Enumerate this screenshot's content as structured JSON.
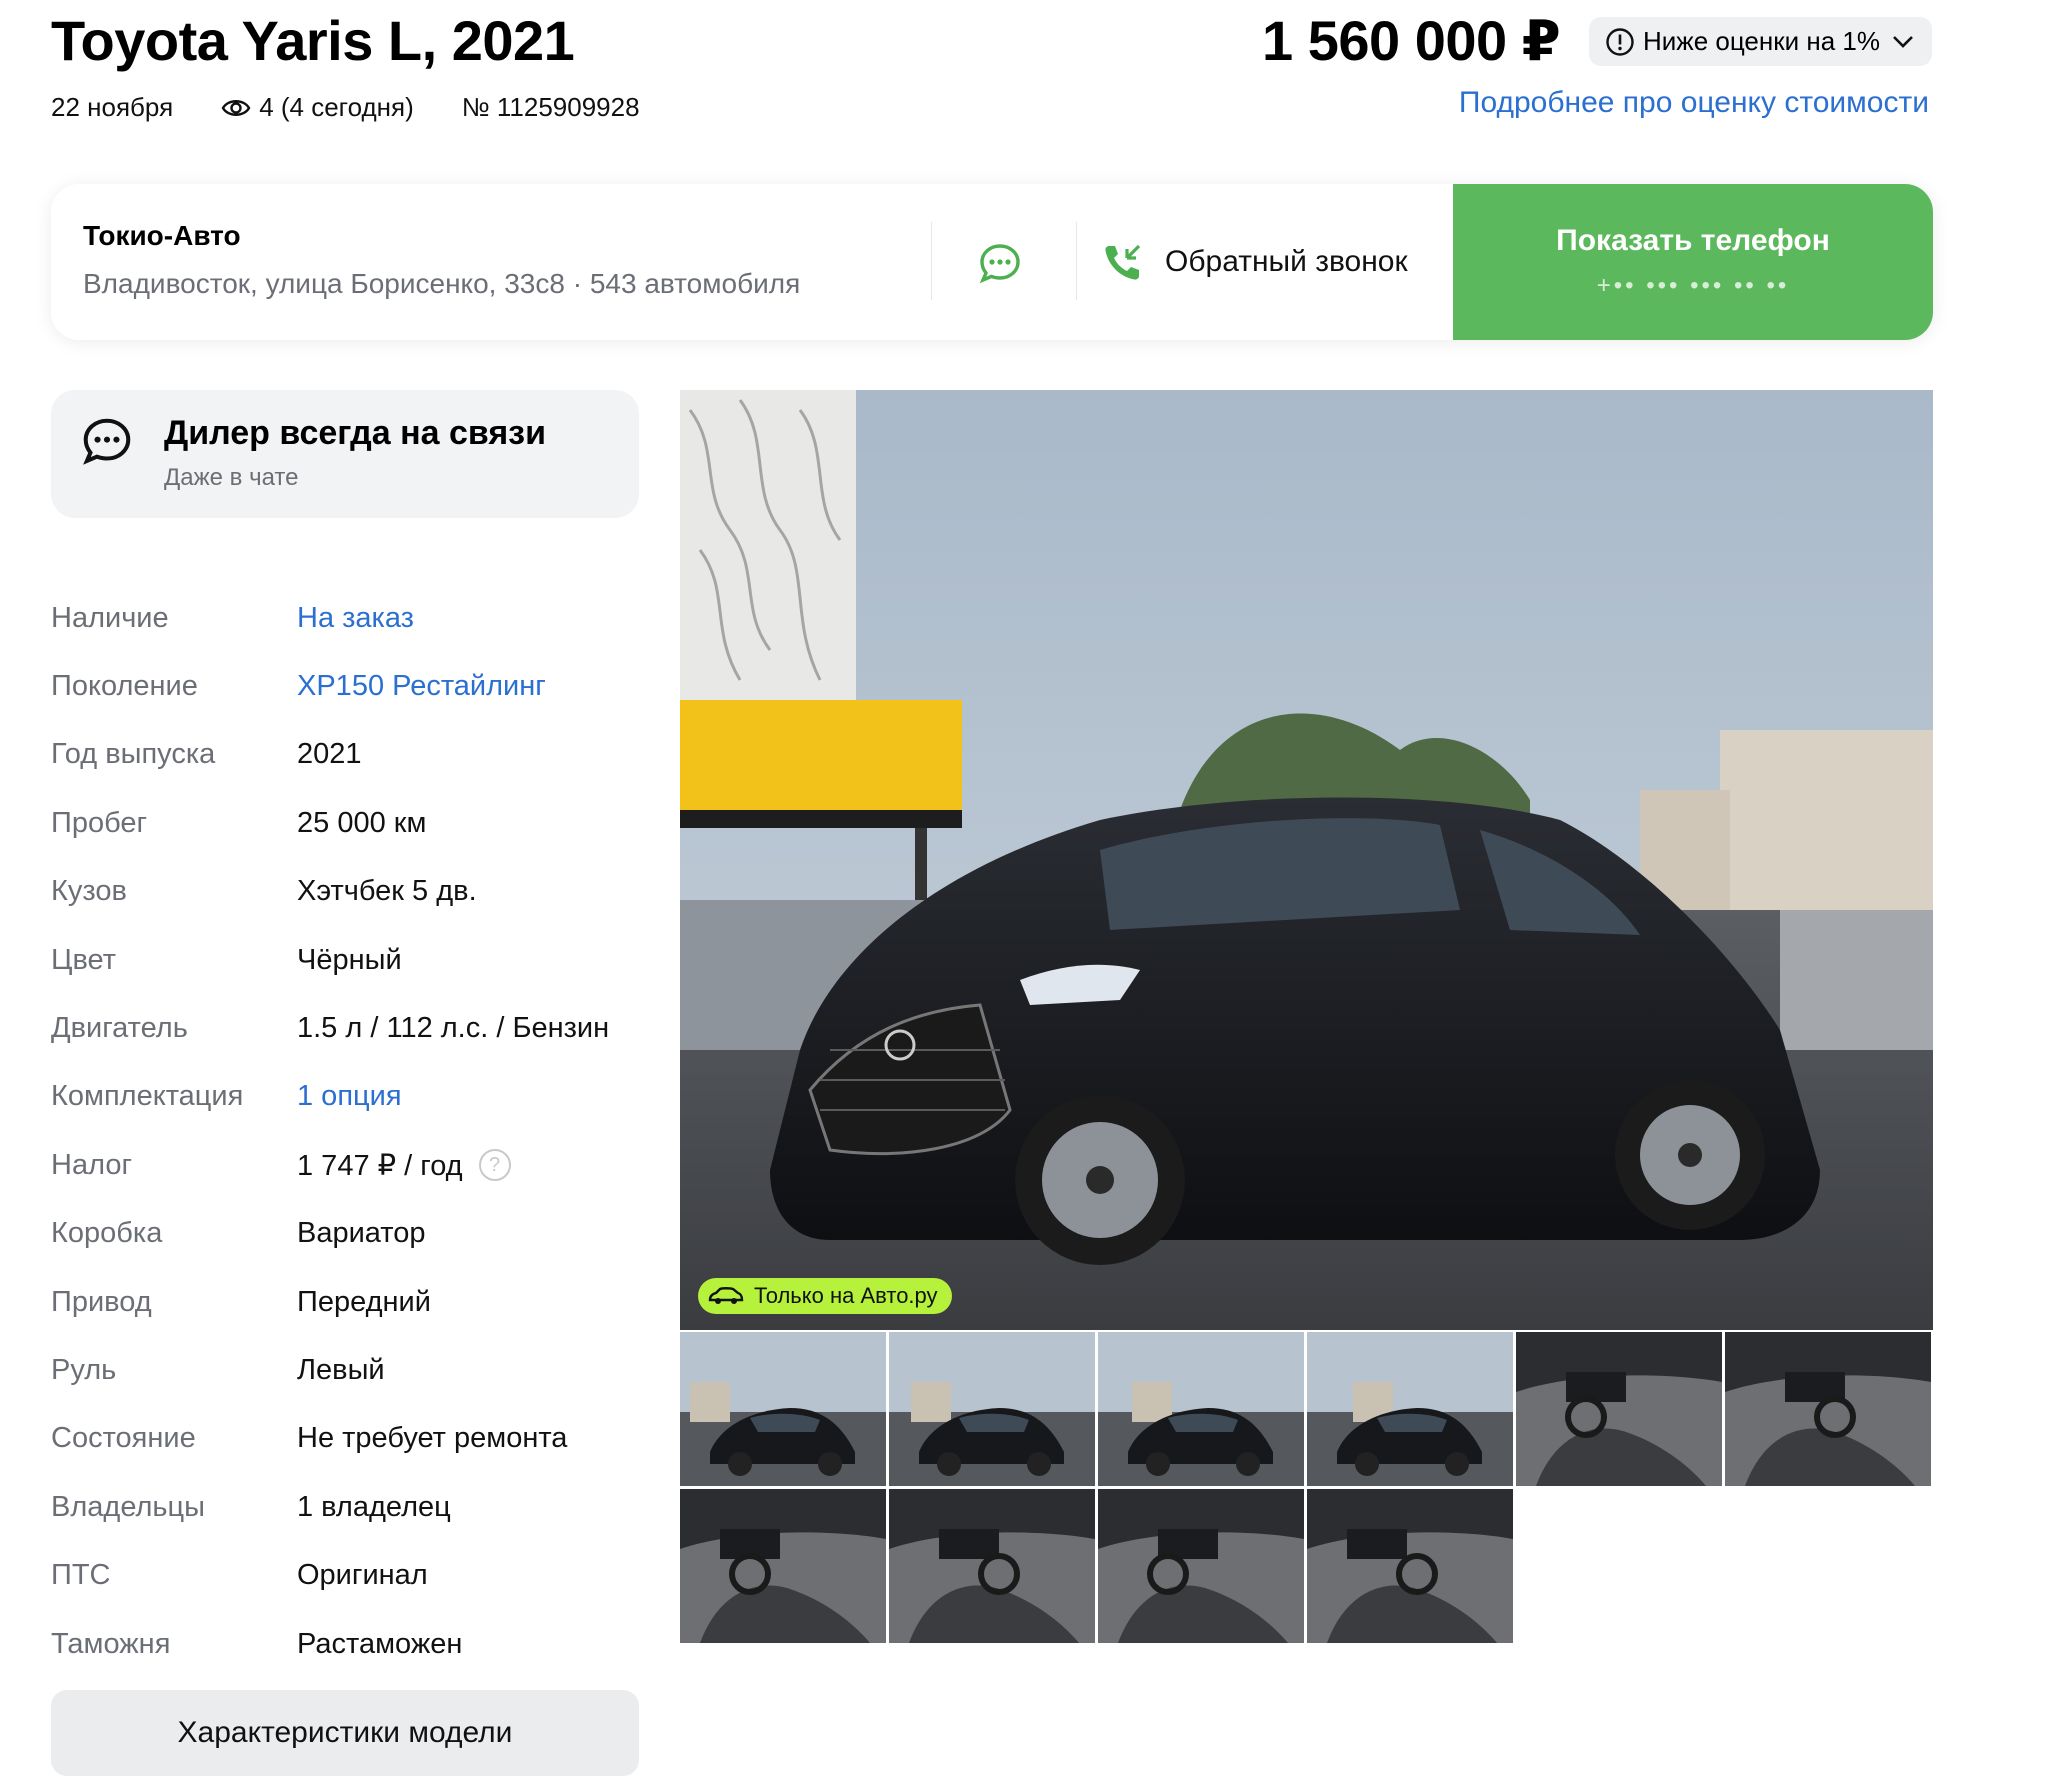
{
  "listing": {
    "title": "Toyota Yaris L, 2021",
    "date": "22 ноября",
    "views": "4 (4 сегодня)",
    "number": "№ 1125909928",
    "price": "1 560 000 ₽",
    "price_badge": "Ниже оценки на 1%",
    "eval_link": "Подробнее про оценку стоимости"
  },
  "dealer": {
    "name": "Токио-Авто",
    "address": "Владивосток, улица Борисенко, 33с8 · 543 автомобиля",
    "callback_label": "Обратный звонок",
    "phone_label": "Показать телефон",
    "phone_masked": "+•• ••• ••• •• ••"
  },
  "contact_box": {
    "title": "Дилер всегда на связи",
    "subtitle": "Даже в чате"
  },
  "specs": [
    {
      "label": "Наличие",
      "value": "На заказ",
      "link": true
    },
    {
      "label": "Поколение",
      "value": "XP150 Рестайлинг",
      "link": true
    },
    {
      "label": "Год выпуска",
      "value": "2021",
      "link": false
    },
    {
      "label": "Пробег",
      "value": "25 000 км",
      "link": false
    },
    {
      "label": "Кузов",
      "value": "Хэтчбек 5 дв.",
      "link": false
    },
    {
      "label": "Цвет",
      "value": "Чёрный",
      "link": false
    },
    {
      "label": "Двигатель",
      "value": "1.5 л / 112 л.с. / Бензин",
      "link": false
    },
    {
      "label": "Комплектация",
      "value": "1 опция",
      "link": true
    },
    {
      "label": "Налог",
      "value": "1 747 ₽ / год",
      "link": false,
      "help": true
    },
    {
      "label": "Коробка",
      "value": "Вариатор",
      "link": false
    },
    {
      "label": "Привод",
      "value": "Передний",
      "link": false
    },
    {
      "label": "Руль",
      "value": "Левый",
      "link": false
    },
    {
      "label": "Состояние",
      "value": "Не требует ремонта",
      "link": false
    },
    {
      "label": "Владельцы",
      "value": "1 владелец",
      "link": false
    },
    {
      "label": "ПТС",
      "value": "Оригинал",
      "link": false
    },
    {
      "label": "Таможня",
      "value": "Растаможен",
      "link": false
    }
  ],
  "model_button": "Характеристики модели",
  "gallery": {
    "only_badge": "Только на Авто.ру",
    "thumbnails": [
      "exterior",
      "exterior",
      "exterior",
      "exterior",
      "interior",
      "interior",
      "interior",
      "interior",
      "interior",
      "interior"
    ]
  },
  "colors": {
    "accent_green": "#5cb85c",
    "link_blue": "#2b6fd1",
    "badge_lime": "#b6f23b"
  }
}
